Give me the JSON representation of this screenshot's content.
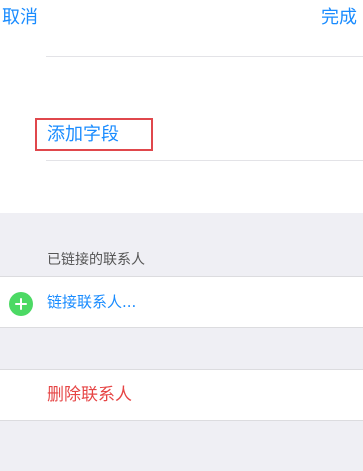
{
  "nav": {
    "cancel_label": "取消",
    "done_label": "完成"
  },
  "fields": {
    "add_field_label": "添加字段"
  },
  "linked_contacts": {
    "header": "已链接的联系人",
    "link_label": "链接联系人..."
  },
  "actions": {
    "delete_label": "删除联系人"
  },
  "colors": {
    "accent": "#1a8cff",
    "destructive": "#e64545",
    "add_icon": "#4cd964",
    "highlight_border": "#e0474c",
    "background": "#efeff4"
  },
  "icons": {
    "link_contact": "plus-circle-icon"
  }
}
